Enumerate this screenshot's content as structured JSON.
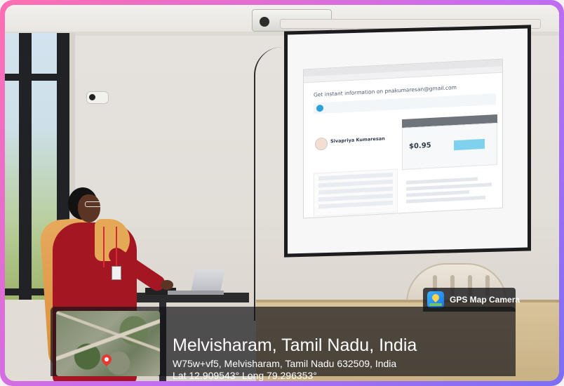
{
  "slide": {
    "heading": "Get instant information on pnakumaresan@gmail.com",
    "profile_name": "Sivapriya Kumaresan",
    "price": "$0.95"
  },
  "gps_overlay": {
    "brand": "GPS Map Camera",
    "location_title": "Melvisharam, Tamil Nadu, India",
    "address": "W75w+vf5, Melvisharam, Tamil Nadu 632509, India",
    "coordinates": "Lat 12.909543° Long 79.296353°",
    "logo_icon": "gps-map-camera-logo-icon",
    "pin_icon": "map-pin-icon"
  },
  "colors": {
    "frame_gradient_start": "#ff6fb1",
    "frame_gradient_end": "#7a6ff6",
    "overlay_bg": "#141418"
  }
}
